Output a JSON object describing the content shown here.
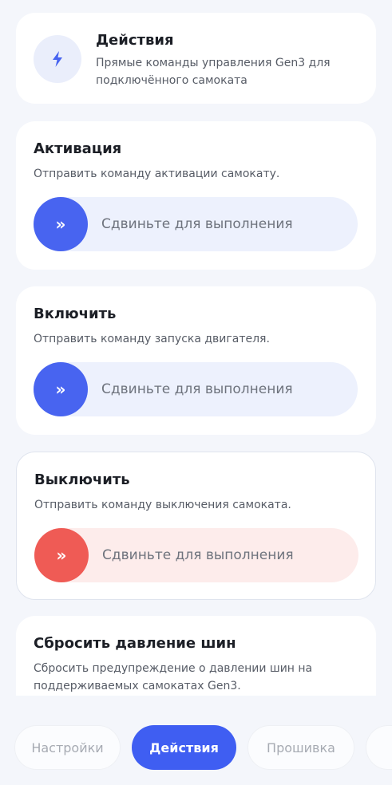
{
  "header": {
    "icon": "lightning-icon",
    "title": "Действия",
    "subtitle": "Прямые команды управления Gen3 для подключённого самоката"
  },
  "actions": [
    {
      "title": "Активация",
      "description": "Отправить команду активации самокату.",
      "slider_label": "Сдвиньте для выполнения",
      "variant": "primary"
    },
    {
      "title": "Включить",
      "description": "Отправить команду запуска двигателя.",
      "slider_label": "Сдвиньте для выполнения",
      "variant": "primary"
    },
    {
      "title": "Выключить",
      "description": "Отправить команду выключения самоката.",
      "slider_label": "Сдвиньте для выполнения",
      "variant": "danger"
    },
    {
      "title": "Сбросить давление шин",
      "description": "Сбросить предупреждение о давлении шин на поддерживаемых самокатах Gen3."
    }
  ],
  "nav": {
    "items": [
      {
        "label": "Настройки",
        "active": false
      },
      {
        "label": "Действия",
        "active": true
      },
      {
        "label": "Прошивка",
        "active": false
      }
    ]
  },
  "colors": {
    "accent": "#3f5ef2",
    "danger": "#ef5b55",
    "background": "#f4f6fb"
  }
}
